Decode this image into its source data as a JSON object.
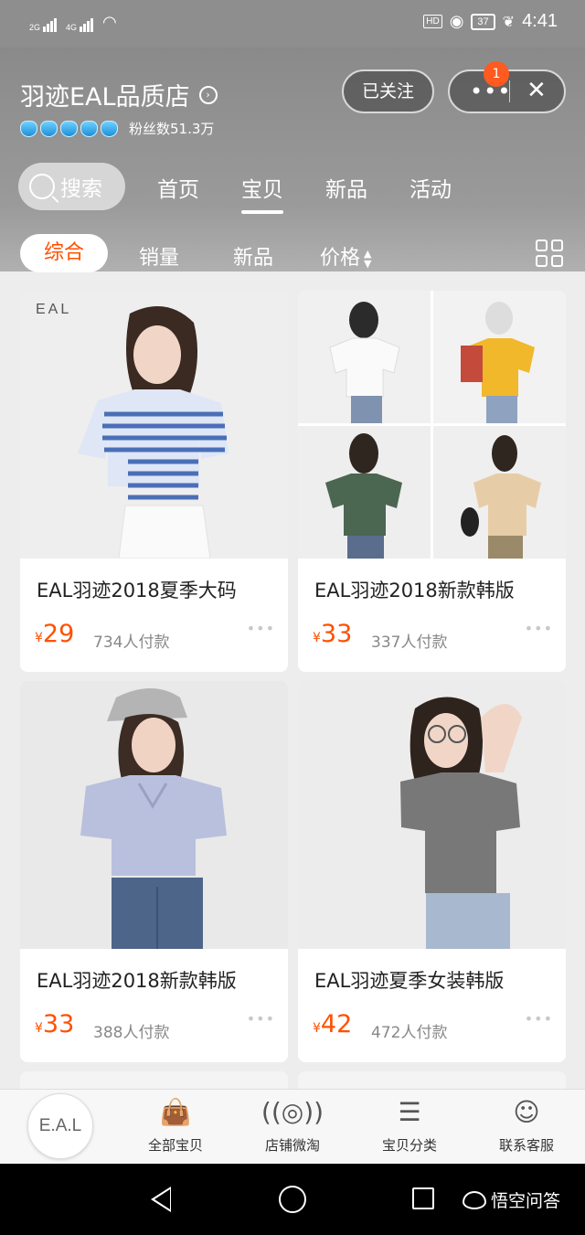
{
  "status_bar": {
    "sim1": "2G",
    "sim2": "4G",
    "hd": "HD",
    "battery": "37",
    "time": "4:41"
  },
  "shop": {
    "name": "羽迹EAL品质店",
    "fans_label": "粉丝数51.3万",
    "follow_label": "已关注",
    "notification_count": "1"
  },
  "nav": {
    "search_label": "搜索",
    "items": [
      "首页",
      "宝贝",
      "新品",
      "活动"
    ],
    "active": "宝贝"
  },
  "filters": {
    "items": [
      "综合",
      "销量",
      "新品",
      "价格"
    ],
    "active": "综合"
  },
  "products": [
    {
      "name": "EAL羽迹2018夏季大码",
      "price_symbol": "¥",
      "price": "29",
      "sold": "734人付款",
      "image": "striped-tee-white-skirt",
      "logo": "EAL"
    },
    {
      "name": "EAL羽迹2018新款韩版",
      "price_symbol": "¥",
      "price": "33",
      "sold": "337人付款",
      "image": "tee-color-collage"
    },
    {
      "name": "EAL羽迹2018新款韩版",
      "price_symbol": "¥",
      "price": "33",
      "sold": "388人付款",
      "image": "lilac-vneck-tee-cap"
    },
    {
      "name": "EAL羽迹夏季女装韩版",
      "price_symbol": "¥",
      "price": "42",
      "sold": "472人付款",
      "image": "grey-vneck-crop-tee"
    }
  ],
  "shop_bar": {
    "logo_text": "E.A.L",
    "tabs": [
      {
        "label": "全部宝贝",
        "icon": "bag-icon"
      },
      {
        "label": "店铺微淘",
        "icon": "broadcast-icon"
      },
      {
        "label": "宝贝分类",
        "icon": "list-icon"
      },
      {
        "label": "联系客服",
        "icon": "chat-bubble-icon"
      }
    ]
  },
  "watermark": "悟空问答",
  "colors": {
    "accent": "#ff5000",
    "header_grey": "#8e8e8e"
  }
}
